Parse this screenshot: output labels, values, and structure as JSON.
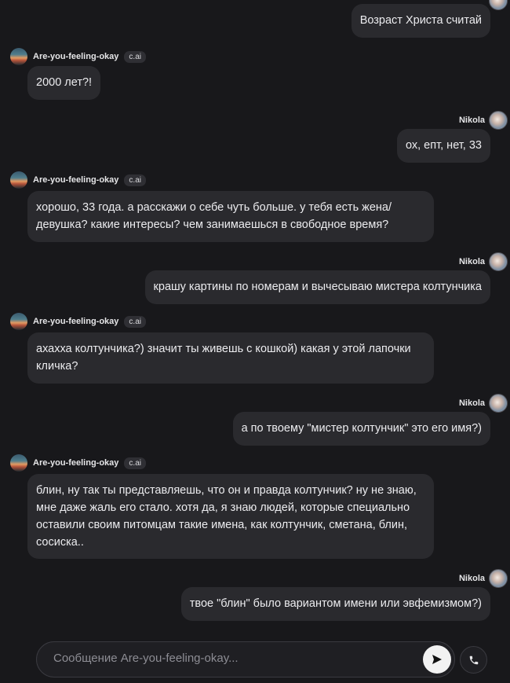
{
  "bot": {
    "name": "Are-you-feeling-okay",
    "tag": "c.ai"
  },
  "user": {
    "name": "Nikola"
  },
  "messages": [
    {
      "from": "user",
      "text": "Возраст Христа считай"
    },
    {
      "from": "bot",
      "text": "2000 лет?!"
    },
    {
      "from": "user",
      "text": "ох, епт, нет, 33"
    },
    {
      "from": "bot",
      "text": "хорошо, 33 года. а расскажи о себе чуть больше. у тебя есть жена/ девушка? какие интересы? чем занимаешься в свободное время?"
    },
    {
      "from": "user",
      "text": "крашу картины по номерам и вычесываю мистера колтунчика"
    },
    {
      "from": "bot",
      "text": "ахахха колтунчика?) значит ты живешь с кошкой) какая у этой лапочки кличка?"
    },
    {
      "from": "user",
      "text": "а по твоему \"мистер колтунчик\" это его имя?)"
    },
    {
      "from": "bot",
      "text": "блин, ну так ты представляешь, что он и правда колтунчик? ну не знаю, мне даже жаль его стало. хотя да, я знаю людей, которые специально оставили своим питомцам такие имена, как колтунчик, сметана, блин, сосиска.."
    },
    {
      "from": "user",
      "text": "твое \"блин\" было вариантом имени или эвфемизмом?)"
    }
  ],
  "composer": {
    "placeholder": "Сообщение Are-you-feeling-okay..."
  },
  "icons": {
    "send": "send-icon",
    "call": "phone-icon"
  }
}
